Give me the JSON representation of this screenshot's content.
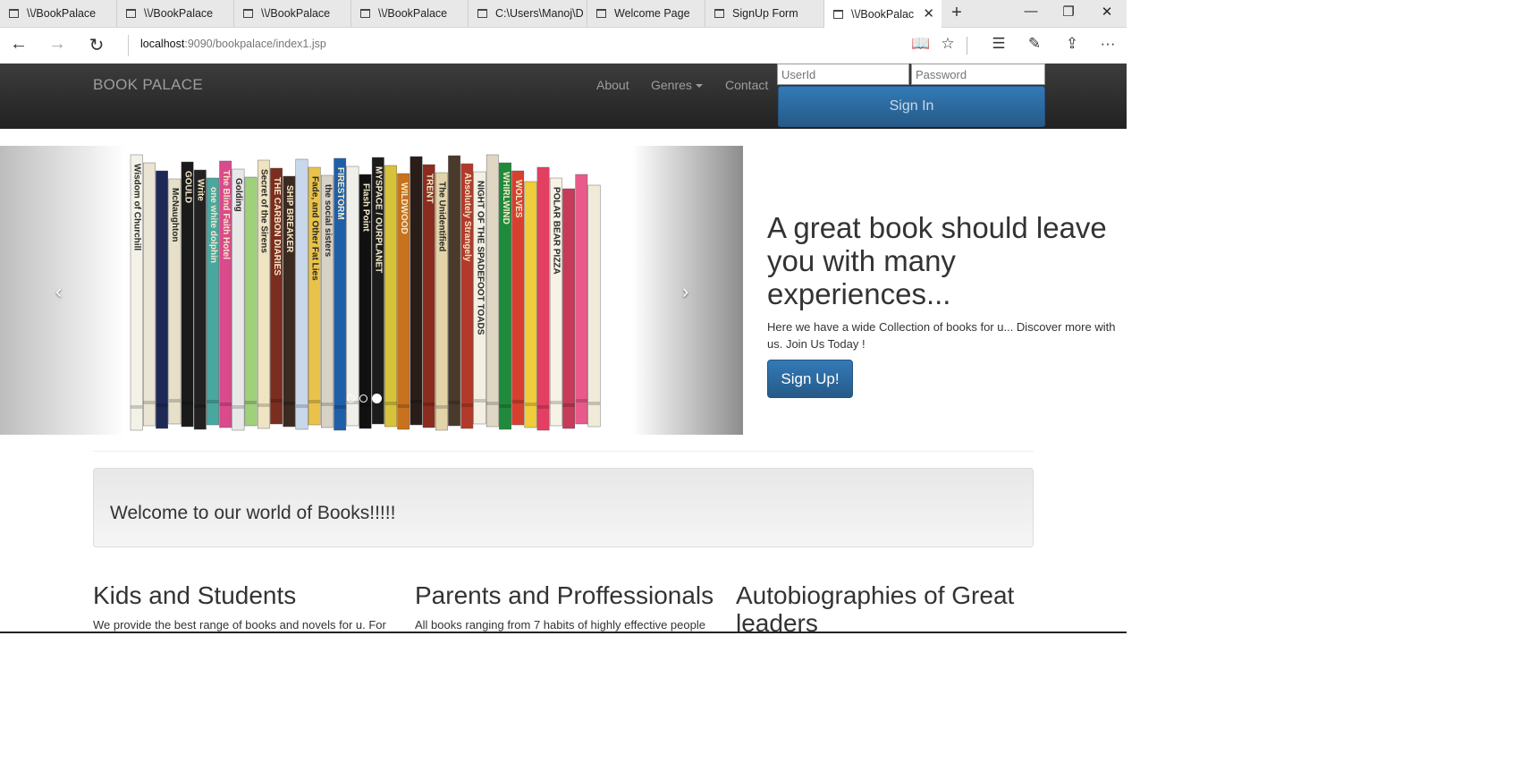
{
  "browser": {
    "tabs": [
      {
        "label": "\\\\/BookPalace"
      },
      {
        "label": "\\\\/BookPalace"
      },
      {
        "label": "\\\\/BookPalace"
      },
      {
        "label": "\\\\/BookPalace"
      },
      {
        "label": "C:\\Users\\Manoj\\D"
      },
      {
        "label": "Welcome Page"
      },
      {
        "label": "SignUp Form"
      },
      {
        "label": "\\\\/BookPalac"
      }
    ],
    "new_tab": "+",
    "close_tab": "✕",
    "window": {
      "minimize": "—",
      "restore": "❐",
      "close": "✕"
    },
    "nav": {
      "back": "←",
      "forward": "→",
      "refresh": "↻"
    },
    "url_host": "localhost",
    "url_path": ":9090/bookpalace/index1.jsp",
    "tools": {
      "reading": "📖",
      "favorite": "☆",
      "hub": "☰",
      "notes": "✎",
      "share": "⇪",
      "more": "···"
    }
  },
  "site": {
    "brand": "BOOK PALACE",
    "nav": {
      "about": "About",
      "genres": "Genres",
      "contact": "Contact"
    },
    "login": {
      "userid_placeholder": "UserId",
      "password_placeholder": "Password",
      "signin": "Sign In"
    },
    "carousel": {
      "prev": "‹",
      "next": "›",
      "slides": 3,
      "active_slide": 3
    },
    "hero": {
      "title": "A great book should leave you with many experiences...",
      "text": "Here we have a wide Collection of books for u... Discover more with us. Join Us Today !",
      "signup": "Sign Up!"
    },
    "welcome": "Welcome to our world of Books!!!!!",
    "columns": [
      {
        "heading": "Kids and Students",
        "text": "We provide the best range of books and novels for u. For"
      },
      {
        "heading": "Parents and Proffessionals",
        "text": "All books ranging from 7 habits of highly effective people"
      },
      {
        "heading": "Autobiographies of Great leaders",
        "text": ""
      }
    ]
  },
  "book_spines": [
    {
      "color": "#f4f1e6",
      "title": "Wisdom of Churchill"
    },
    {
      "color": "#e9e4d3",
      "title": ""
    },
    {
      "color": "#1e2a55",
      "title": ""
    },
    {
      "color": "#e6e0c8",
      "title": "McNaughton"
    },
    {
      "color": "#1a1a1a",
      "title": "GOULD"
    },
    {
      "color": "#222222",
      "title": "Write"
    },
    {
      "color": "#4aa7a0",
      "title": "one white dolphin"
    },
    {
      "color": "#d94b8c",
      "title": "The Blind Faith Hotel"
    },
    {
      "color": "#e8e8e8",
      "title": "Golding"
    },
    {
      "color": "#9fd07a",
      "title": ""
    },
    {
      "color": "#efe3c2",
      "title": "Secret of the Sirens"
    },
    {
      "color": "#7b2d1f",
      "title": "THE CARBON DIARIES"
    },
    {
      "color": "#3b2a20",
      "title": "SHIP BREAKER"
    },
    {
      "color": "#c9d7ea",
      "title": ""
    },
    {
      "color": "#e9c24a",
      "title": "Fade, and Other Fat Lies"
    },
    {
      "color": "#d8d2c6",
      "title": "the social sisters"
    },
    {
      "color": "#1f5fa8",
      "title": "FIRESTORM"
    },
    {
      "color": "#f1efe9",
      "title": ""
    },
    {
      "color": "#111111",
      "title": "Flash Point"
    },
    {
      "color": "#1c1c1c",
      "title": "MYSPACE / OURPLANET"
    },
    {
      "color": "#d8c23a",
      "title": ""
    },
    {
      "color": "#c8721e",
      "title": "WILDWOOD"
    },
    {
      "color": "#2a1d17",
      "title": ""
    },
    {
      "color": "#8a2c1e",
      "title": "TRENT"
    },
    {
      "color": "#e2d4a8",
      "title": "The Unidentified"
    },
    {
      "color": "#4a3a2c",
      "title": ""
    },
    {
      "color": "#b33a2a",
      "title": "Absolutely Strangely"
    },
    {
      "color": "#f3efe2",
      "title": "NIGHT OF THE SPADEFOOT TOADS"
    },
    {
      "color": "#e0d6c4",
      "title": ""
    },
    {
      "color": "#1f8a3a",
      "title": "WHIRLWIND"
    },
    {
      "color": "#d7402f",
      "title": "WOLVES"
    },
    {
      "color": "#f2cd3a",
      "title": ""
    },
    {
      "color": "#e33f63",
      "title": ""
    },
    {
      "color": "#f6f2e5",
      "title": "POLAR BEAR PIZZA"
    },
    {
      "color": "#c73a5a",
      "title": ""
    },
    {
      "color": "#e85a8a",
      "title": ""
    },
    {
      "color": "#f0ead8",
      "title": ""
    }
  ]
}
